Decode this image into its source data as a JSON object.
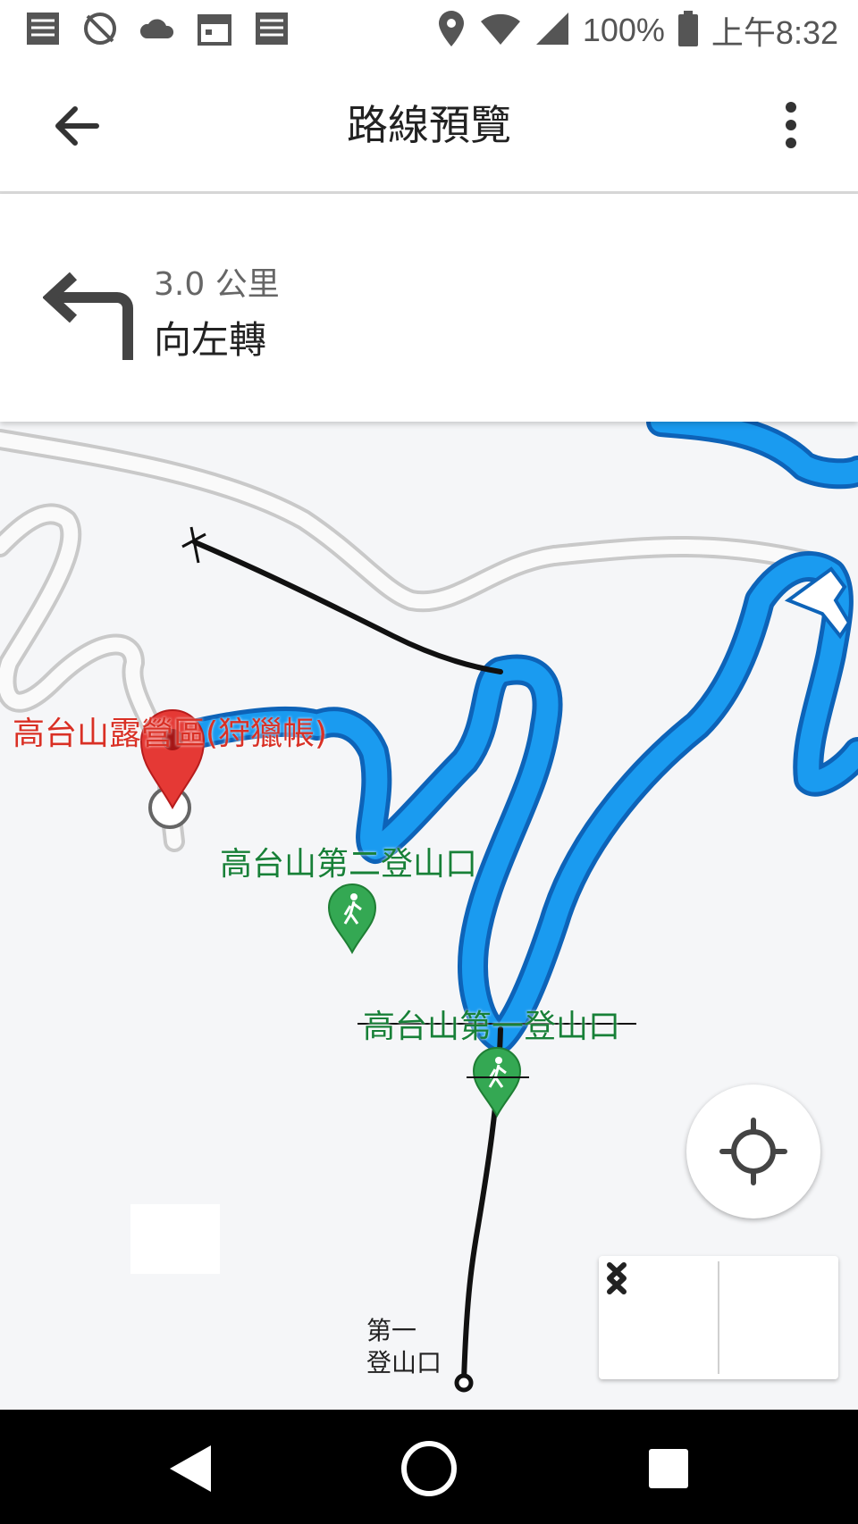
{
  "status_bar": {
    "battery": "100%",
    "time": "上午8:32",
    "left_icons": [
      "notification-icon",
      "vpn-icon",
      "cloud-icon",
      "calendar-icon",
      "notification-icon"
    ],
    "right_icons": [
      "location-icon",
      "wifi-icon",
      "signal-icon",
      "battery-icon"
    ]
  },
  "app_bar": {
    "title": "路線預覽"
  },
  "navigation": {
    "distance": "3.0 公里",
    "instruction": "向左轉",
    "icon": "turn-left-icon"
  },
  "map": {
    "destination_label": "高台山露營區(狩獵帳)",
    "trailhead_2_label": "高台山第二登山口",
    "trailhead_1_label": "高台山第一登山口",
    "handwritten_label_line1": "第一",
    "handwritten_label_line2": "登山口",
    "colors": {
      "route": "#1a9bf0",
      "route_border": "#0d63b8",
      "road": "#d9d9d9",
      "destination_pin": "#e53935",
      "trail_pin": "#34a853"
    }
  },
  "bottom_nav": [
    "back-icon",
    "home-icon",
    "recents-icon"
  ]
}
